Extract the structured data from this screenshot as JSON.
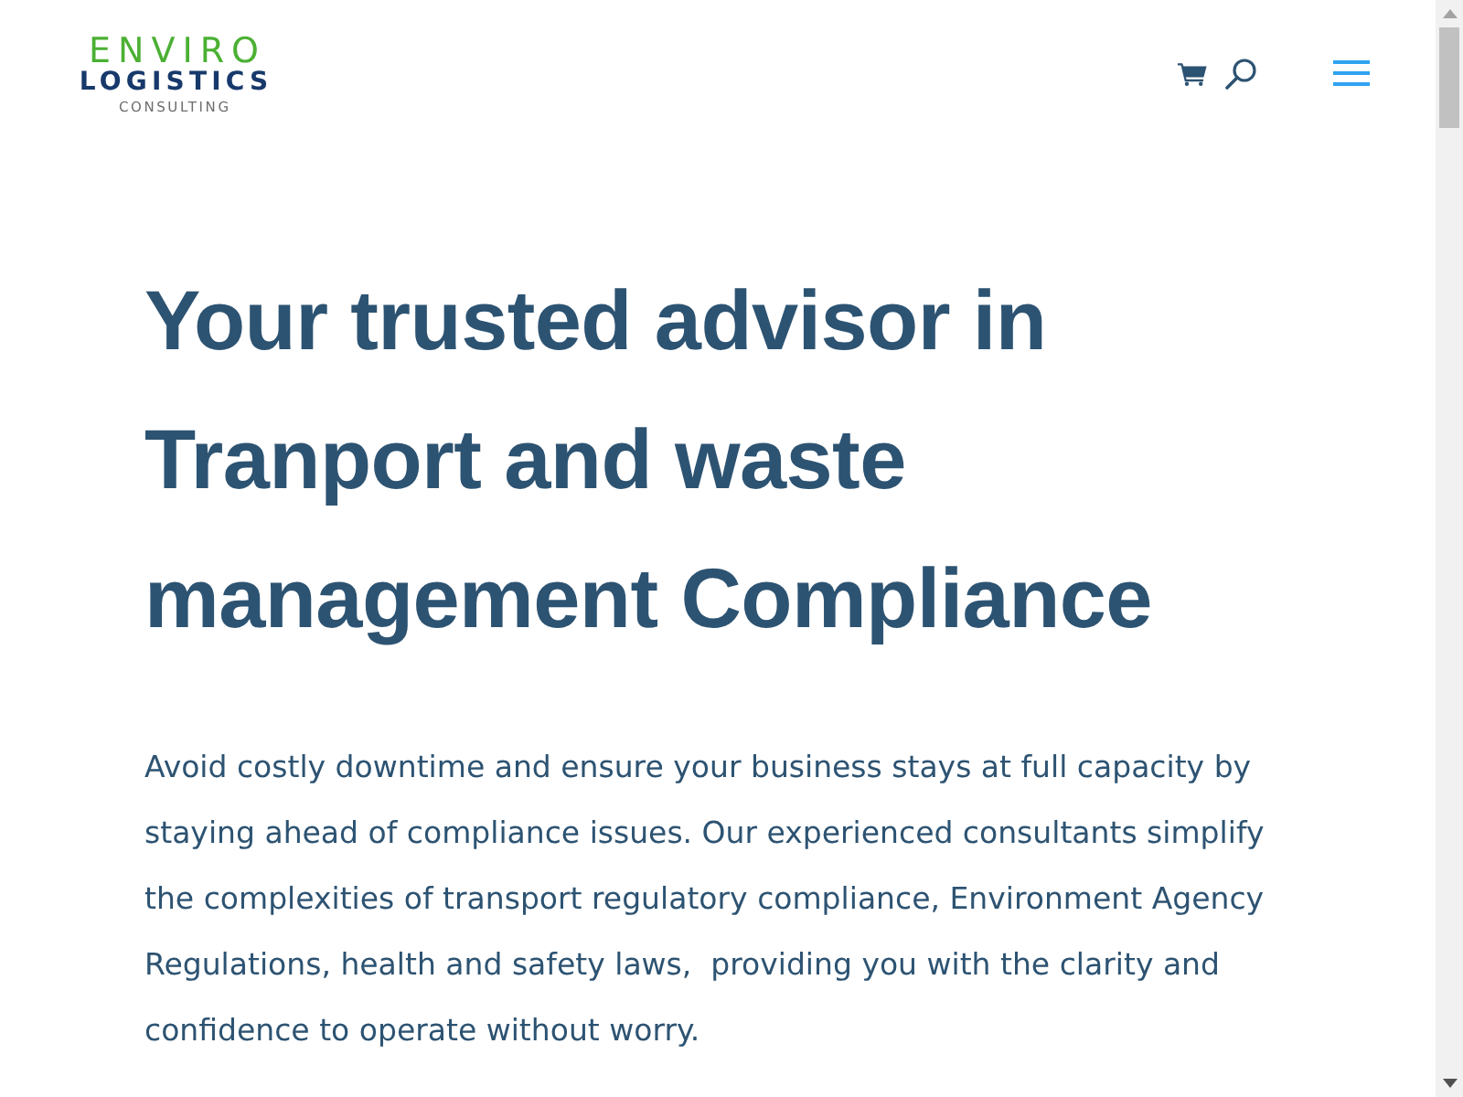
{
  "header": {
    "logo": {
      "line_1": "ENVIRO",
      "line_2": "LOGISTICS",
      "line_3": "CONSULTING"
    }
  },
  "hero": {
    "heading": "Your trusted advisor in Tranport and waste management Compliance",
    "body": "Avoid costly downtime and ensure your business stays at full capacity by staying ahead of compliance issues. Our experienced consultants simplify the complexities of transport regulatory compliance, Environment Agency Regulations, health and safety laws,  providing you with the clarity and confidence to operate without worry."
  }
}
